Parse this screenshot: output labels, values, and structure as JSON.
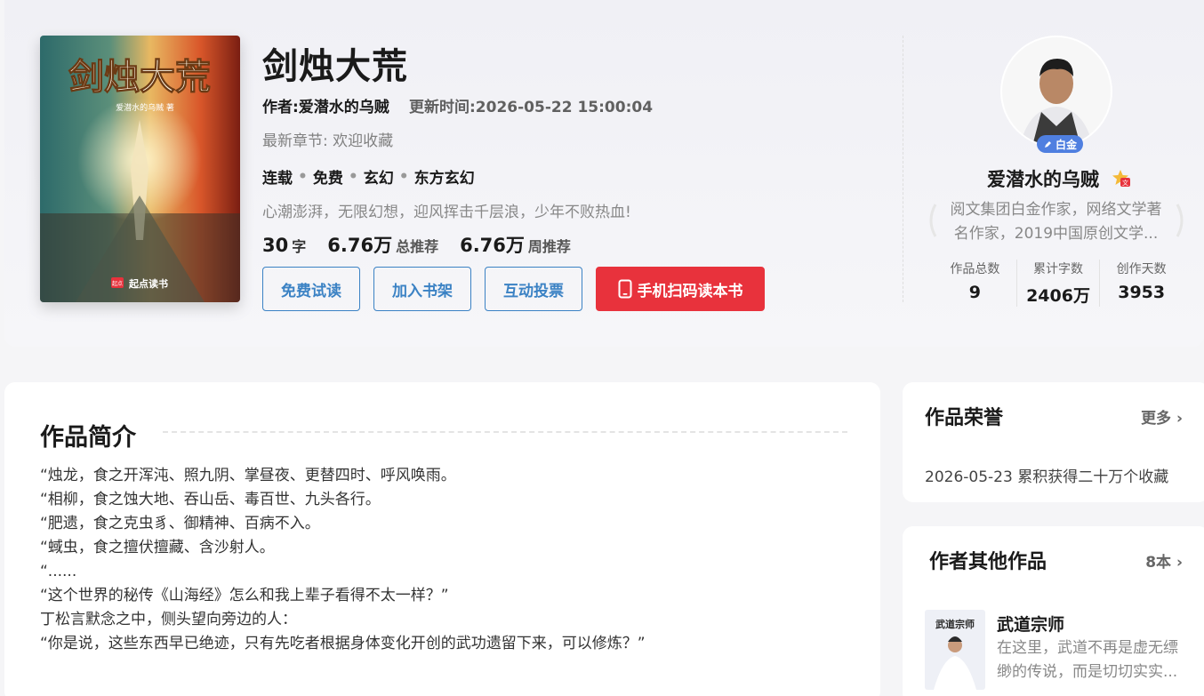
{
  "book": {
    "title": "剑烛大荒",
    "author_line": "作者:爱潜水的乌贼",
    "update_line": "更新时间:2026-05-22 15:00:04",
    "latest_chapter": "最新章节: 欢迎收藏",
    "tags": [
      "连载",
      "免费",
      "玄幻",
      "东方玄幻"
    ],
    "slogan": "心潮澎湃，无限幻想，迎风挥击千层浪，少年不败热血!",
    "stats": {
      "words": "30",
      "words_unit": "字",
      "total_rec": "6.76万",
      "total_rec_label": "总推荐",
      "week_rec": "6.76万",
      "week_rec_label": "周推荐"
    },
    "cover": {
      "title_text": "剑烛大荒",
      "author_text": "爱潜水的乌贼 著",
      "publisher": "起点读书",
      "publisher_logo": "起点"
    }
  },
  "actions": {
    "free_read": "免费试读",
    "add_shelf": "加入书架",
    "vote": "互动投票",
    "scan": "手机扫码读本书"
  },
  "author": {
    "badge": "白金",
    "name": "爱潜水的乌贼",
    "level_icon": "文",
    "desc_line1": "阅文集团白金作家，网络文学著",
    "desc_line2": "名作家，2019中国原创文学...",
    "stats": [
      {
        "label": "作品总数",
        "value": "9"
      },
      {
        "label": "累计字数",
        "value": "2406万"
      },
      {
        "label": "创作天数",
        "value": "3953"
      }
    ]
  },
  "intro": {
    "title": "作品简介",
    "body": "“烛龙，食之开浑沌、照九阴、掌昼夜、更替四时、呼风唤雨。\n“相柳，食之蚀大地、吞山岳、毒百世、九头各行。\n“肥遗，食之克虫豸、御精神、百病不入。\n“蜮虫，食之擅伏擅藏、含沙射人。\n“......\n“这个世界的秘传《山海经》怎么和我上辈子看得不太一样？”\n丁松言默念之中，侧头望向旁边的人：\n“你是说，这些东西早已绝迹，只有先吃者根据身体变化开创的武功遗留下来，可以修炼？”"
  },
  "honors": {
    "title": "作品荣誉",
    "more": "更多",
    "item": "2026-05-23 累积获得二十万个收藏"
  },
  "other_works": {
    "title": "作者其他作品",
    "count": "8本",
    "item_title": "武道宗师",
    "item_desc_line1": "在这里，武道不再是虚无缥",
    "item_desc_line2": "缈的传说，而是切切实实...",
    "item_cover_text": "武道宗师"
  },
  "colors": {
    "accent_blue": "#3b82c4",
    "accent_red": "#e8323c",
    "badge_blue": "#4f7fe0"
  }
}
